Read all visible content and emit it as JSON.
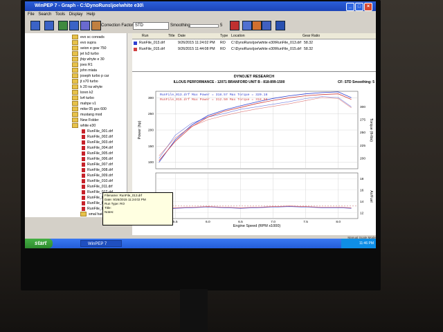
{
  "window": {
    "title": "WinPEP 7 - Graph - C:\\DynoRuns\\joe\\white e30\\"
  },
  "menu": [
    "File",
    "Search",
    "Tools",
    "Display",
    "Help"
  ],
  "toolbar": {
    "correction_label": "Correction Factor",
    "correction_value": "STD",
    "smoothing_label": "Smoothing",
    "smoothing_value": "5"
  },
  "tree": {
    "folders": [
      "evo sc conrads",
      "evo supra",
      "seion e gsw 750",
      "jet ls3 turbo",
      "jhip whyte e 30",
      "joes R1",
      "john miata",
      "joseph turbo p car",
      "jt s70 turbo",
      "k 20 na whyte",
      "loren k2",
      "ls4 turbo",
      "mahpe v1",
      "mike 05 gsx 600",
      "mustang mod",
      "New Folder",
      "white e30"
    ],
    "files": [
      "RunFile_001.drf",
      "RunFile_002.drf",
      "RunFile_003.drf",
      "RunFile_004.drf",
      "RunFile_005.drf",
      "RunFile_006.drf",
      "RunFile_007.drf",
      "RunFile_008.drf",
      "RunFile_009.drf",
      "RunFile_010.drf",
      "RunFile_011.drf",
      "RunFile_012.drf",
      "RunFile_013.drf",
      "RunFile_014.drf",
      "RunFile_015.drf"
    ],
    "after": [
      "smal hatch",
      "smal rk 3t cci",
      "pamk turbo",
      "r b20v e35"
    ]
  },
  "tooltip": {
    "line1": "Filename: RunFile_013.drf",
    "line2": "Date: 9/26/2015 11:24:02 PM",
    "line3": "Run Type: RO",
    "line4": "Title:",
    "line5": "Notes:"
  },
  "runlist": {
    "headers": [
      "Run",
      "Title",
      "Date",
      "Type",
      "Location",
      "Gear Ratio"
    ],
    "rows": [
      {
        "run": "RunFile_013.drf",
        "date": "9/26/2015 11:24:02 PM",
        "type": "RO",
        "location": "C:\\DynoRuns\\joe\\white e30\\RunFile_013.drf",
        "gear": "58.32",
        "color": "#3040d0"
      },
      {
        "run": "RunFile_015.drf",
        "date": "9/26/2015 11:44:08 PM",
        "type": "RO",
        "location": "C:\\DynoRuns\\joe\\white e30\\RunFile_015.drf",
        "gear": "58.32",
        "color": "#d04040"
      }
    ]
  },
  "graph": {
    "header1": "DYNOJET RESEARCH",
    "header2": "ILLOUS PERFORMANCE - 12071 BRANFORD UNIT B - 818-899-1500",
    "cf": "CF: STD  Smoothing: 5",
    "legend1": "RunFile_013.drf Max Power = 318.57 Max Torque = 320.18",
    "legend2": "RunFile_015.drf Max Power = 312.50 Max Torque = 318.69",
    "xlabel": "Engine Speed (RPM x1000)",
    "ylabel_left": "Power (hp)",
    "ylabel_right": "Torque (ft-lbs)",
    "ylabel_af": "Air/Fuel"
  },
  "chart_data": {
    "type": "line",
    "title": "DYNOJET RESEARCH",
    "xlabel": "Engine Speed (RPM x1000)",
    "ylabel": "Power (hp)",
    "x_ticks": [
      "5.5",
      "6.0",
      "6.5",
      "7.0",
      "7.5",
      "8.0"
    ],
    "power_ticks": [
      100,
      150,
      200,
      250,
      300
    ],
    "torque_ticks": [
      200,
      225,
      250,
      275,
      300
    ],
    "af_ticks": [
      12,
      14,
      16,
      18
    ],
    "x": [
      5.25,
      5.5,
      5.75,
      6.0,
      6.25,
      6.5,
      6.75,
      7.0,
      7.25,
      7.5,
      7.75,
      8.0,
      8.2
    ],
    "series": [
      {
        "name": "RunFile_013.drf",
        "power": [
          100,
          170,
          215,
          245,
          262,
          275,
          287,
          298,
          306,
          312,
          316,
          318,
          300
        ],
        "torque": [
          200,
          245,
          268,
          280,
          287,
          295,
          300,
          305,
          310,
          316,
          320,
          318,
          300
        ],
        "af": [
          12.4,
          12.8,
          12.9,
          13.0,
          12.9,
          12.8,
          12.9,
          13.0,
          13.1,
          13.0,
          12.9,
          12.9,
          12.8
        ],
        "color": "#3040d0"
      },
      {
        "name": "RunFile_015.drf",
        "power": [
          105,
          165,
          210,
          240,
          258,
          270,
          282,
          292,
          300,
          306,
          310,
          312,
          295
        ],
        "torque": [
          205,
          240,
          262,
          275,
          283,
          290,
          296,
          301,
          306,
          312,
          318,
          316,
          298
        ],
        "af": [
          12.6,
          12.9,
          13.0,
          13.1,
          13.0,
          12.9,
          13.0,
          13.1,
          13.2,
          13.1,
          13.0,
          13.0,
          12.9
        ],
        "color": "#d04040"
      }
    ],
    "af_target": 13.2,
    "xlim": [
      5.2,
      8.3
    ],
    "power_ylim": [
      80,
      320
    ],
    "af_ylim": [
      11,
      19
    ]
  },
  "taskbar": {
    "start": "start",
    "app": "WinPEP 7",
    "clock": "11:46 PM"
  },
  "status": "Manual Scale Mode"
}
